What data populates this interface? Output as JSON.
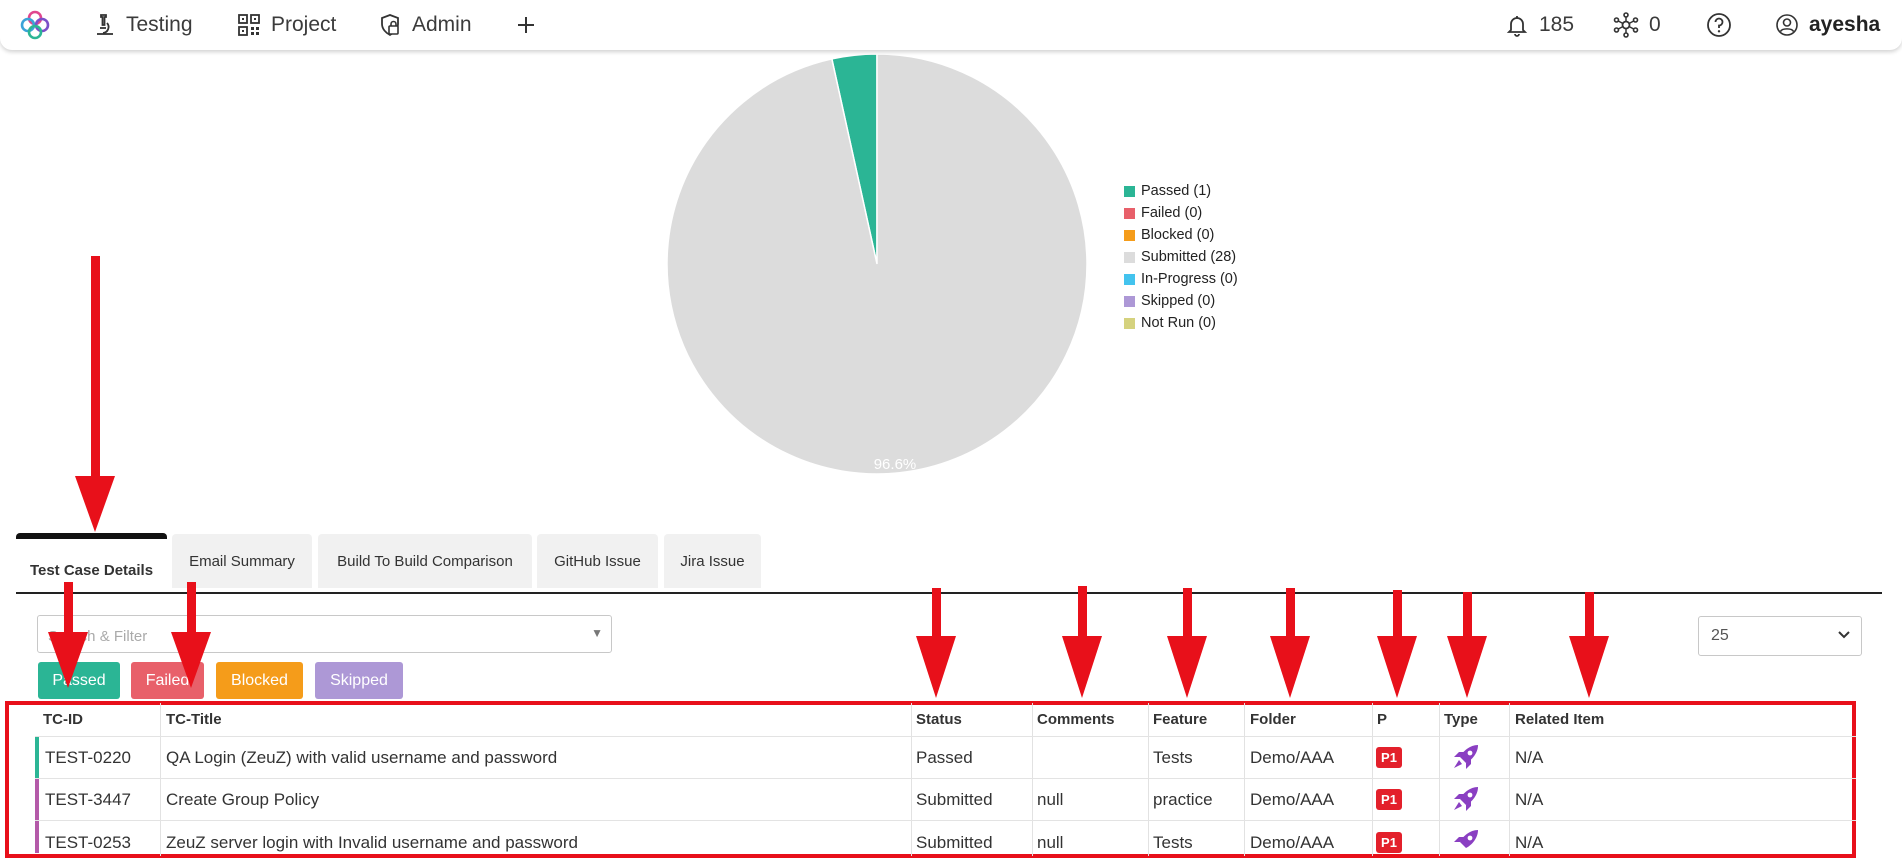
{
  "nav": {
    "testing": "Testing",
    "project": "Project",
    "admin": "Admin",
    "notifications": "185",
    "nodes": "0",
    "user": "ayesha"
  },
  "colors": {
    "passed": "#2bb595",
    "failed": "#e8606a",
    "blocked": "#f59c1a",
    "submitted": "#dcdcdc",
    "in_progress": "#43c3ee",
    "skipped": "#ad98d6",
    "not_run": "#d5d27e",
    "annotation_red": "#e8101a",
    "priority": "#e3202b",
    "rocket": "#8a3fc2"
  },
  "chart_data": {
    "type": "pie",
    "slices": [
      {
        "label": "Passed (1)",
        "value": 1,
        "color": "#2bb595"
      },
      {
        "label": "Failed (0)",
        "value": 0,
        "color": "#e8606a"
      },
      {
        "label": "Blocked (0)",
        "value": 0,
        "color": "#f59c1a"
      },
      {
        "label": "Submitted (28)",
        "value": 28,
        "color": "#dcdcdc"
      },
      {
        "label": "In-Progress (0)",
        "value": 0,
        "color": "#43c3ee"
      },
      {
        "label": "Skipped (0)",
        "value": 0,
        "color": "#ad98d6"
      },
      {
        "label": "Not Run (0)",
        "value": 0,
        "color": "#d5d27e"
      }
    ],
    "data_labels": [
      "96.6%"
    ],
    "legend_position": "right"
  },
  "tabs": [
    {
      "label": "Test Case Details",
      "active": true
    },
    {
      "label": "Email Summary",
      "active": false
    },
    {
      "label": "Build To Build Comparison",
      "active": false
    },
    {
      "label": "GitHub Issue",
      "active": false
    },
    {
      "label": "Jira Issue",
      "active": false
    }
  ],
  "filter": {
    "search_placeholder": "Search & Filter",
    "page_size": "25",
    "chips": [
      "Passed",
      "Failed",
      "Blocked",
      "Skipped"
    ]
  },
  "table": {
    "headers": [
      "TC-ID",
      "TC-Title",
      "Status",
      "Comments",
      "Feature",
      "Folder",
      "P",
      "Type",
      "Related Item"
    ],
    "rows": [
      {
        "id": "TEST-0220",
        "title": "QA Login (ZeuZ) with valid username and password",
        "status": "Passed",
        "comments": "",
        "feature": "Tests",
        "folder": "Demo/AAA",
        "priority": "P1",
        "type": "rocket-icon",
        "related": "N/A",
        "status_color": "#2bb595"
      },
      {
        "id": "TEST-3447",
        "title": "Create Group Policy",
        "status": "Submitted",
        "comments": "null",
        "feature": "practice",
        "folder": "Demo/AAA",
        "priority": "P1",
        "type": "rocket-icon",
        "related": "N/A",
        "status_color": "#b45aa9"
      },
      {
        "id": "TEST-0253",
        "title": "ZeuZ server login with Invalid username and password",
        "status": "Submitted",
        "comments": "null",
        "feature": "Tests",
        "folder": "Demo/AAA",
        "priority": "P1",
        "type": "rocket-icon",
        "related": "N/A",
        "status_color": "#b45aa9"
      }
    ]
  }
}
